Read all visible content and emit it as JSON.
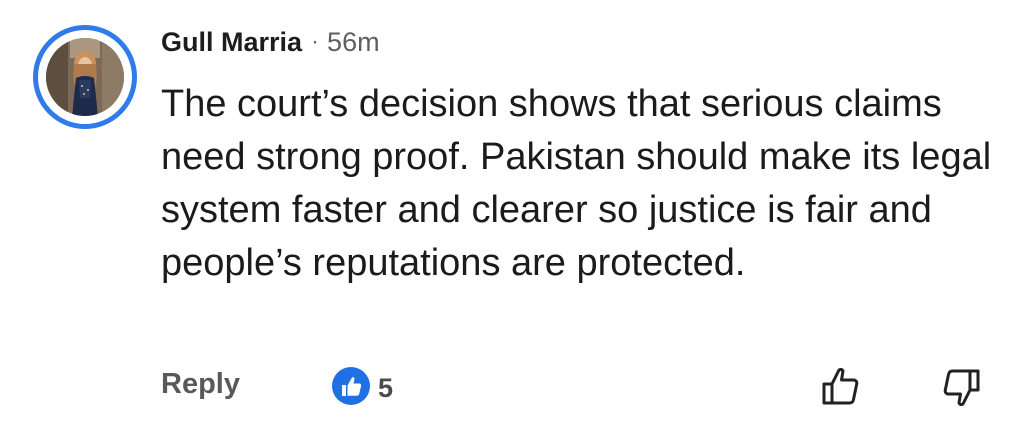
{
  "comment": {
    "author": "Gull Marria",
    "separator": "·",
    "time": "56m",
    "text": "The court’s decision shows that serious claims need strong proof. Pakistan should make its legal system faster and clearer so justice is fair and people’s reputations are protected."
  },
  "actions": {
    "reply_label": "Reply",
    "reaction_count": "5",
    "reaction_icon": "like-reaction-icon",
    "like_icon": "thumbs-up-outline-icon",
    "dislike_icon": "thumbs-down-outline-icon"
  },
  "colors": {
    "avatar_ring": "#2f7bea",
    "reaction_badge": "#1f6fe5"
  }
}
